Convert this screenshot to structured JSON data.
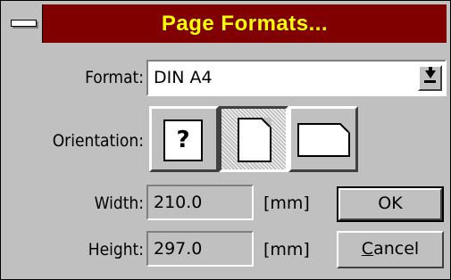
{
  "dialog": {
    "title": "Page Formats...",
    "colors": {
      "titlebar": "#800000",
      "title_text": "#ffff00",
      "face": "#c0c0c0"
    }
  },
  "format": {
    "label": "Format:",
    "value": "DIN A4",
    "dropdown_icon": "dropdown-arrow-icon"
  },
  "orientation": {
    "label": "Orientation:",
    "options": [
      {
        "name": "unknown",
        "text": "?",
        "icon": "page-unknown-icon",
        "selected": false
      },
      {
        "name": "portrait",
        "icon": "page-portrait-icon",
        "selected": true
      },
      {
        "name": "landscape",
        "icon": "page-landscape-icon",
        "selected": false
      }
    ]
  },
  "width": {
    "label": "Width:",
    "value": "210.0",
    "unit": "[mm]"
  },
  "height": {
    "label": "Height:",
    "value": "297.0",
    "unit": "[mm]"
  },
  "buttons": {
    "ok": "OK",
    "cancel_mnemonic": "C",
    "cancel_rest": "ancel"
  }
}
